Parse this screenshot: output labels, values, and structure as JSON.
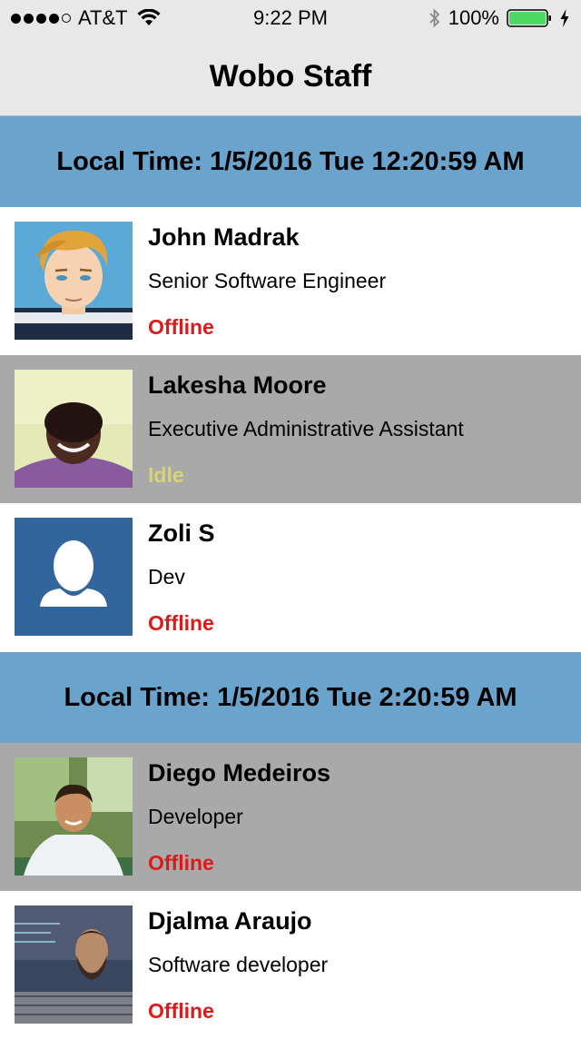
{
  "status_bar": {
    "carrier": "AT&T",
    "time": "9:22 PM",
    "battery": "100%"
  },
  "nav": {
    "title": "Wobo Staff"
  },
  "sections": [
    {
      "header": "Local Time: 1/5/2016 Tue 12:20:59 AM",
      "staff": [
        {
          "name": "John Madrak",
          "role": "Senior Software Engineer",
          "status": "Offline"
        },
        {
          "name": "Lakesha Moore",
          "role": "Executive Administrative Assistant",
          "status": "Idle"
        },
        {
          "name": "Zoli S",
          "role": "Dev",
          "status": "Offline"
        }
      ]
    },
    {
      "header": "Local Time: 1/5/2016 Tue 2:20:59 AM",
      "staff": [
        {
          "name": "Diego Medeiros",
          "role": "Developer",
          "status": "Offline"
        },
        {
          "name": "Djalma Araujo",
          "role": "Software developer",
          "status": "Offline"
        }
      ]
    }
  ],
  "colors": {
    "section_header": "#6aa3cb",
    "offline": "#dd1a1a",
    "idle": "#d6d56e",
    "grey_row": "#a9a9a9"
  }
}
